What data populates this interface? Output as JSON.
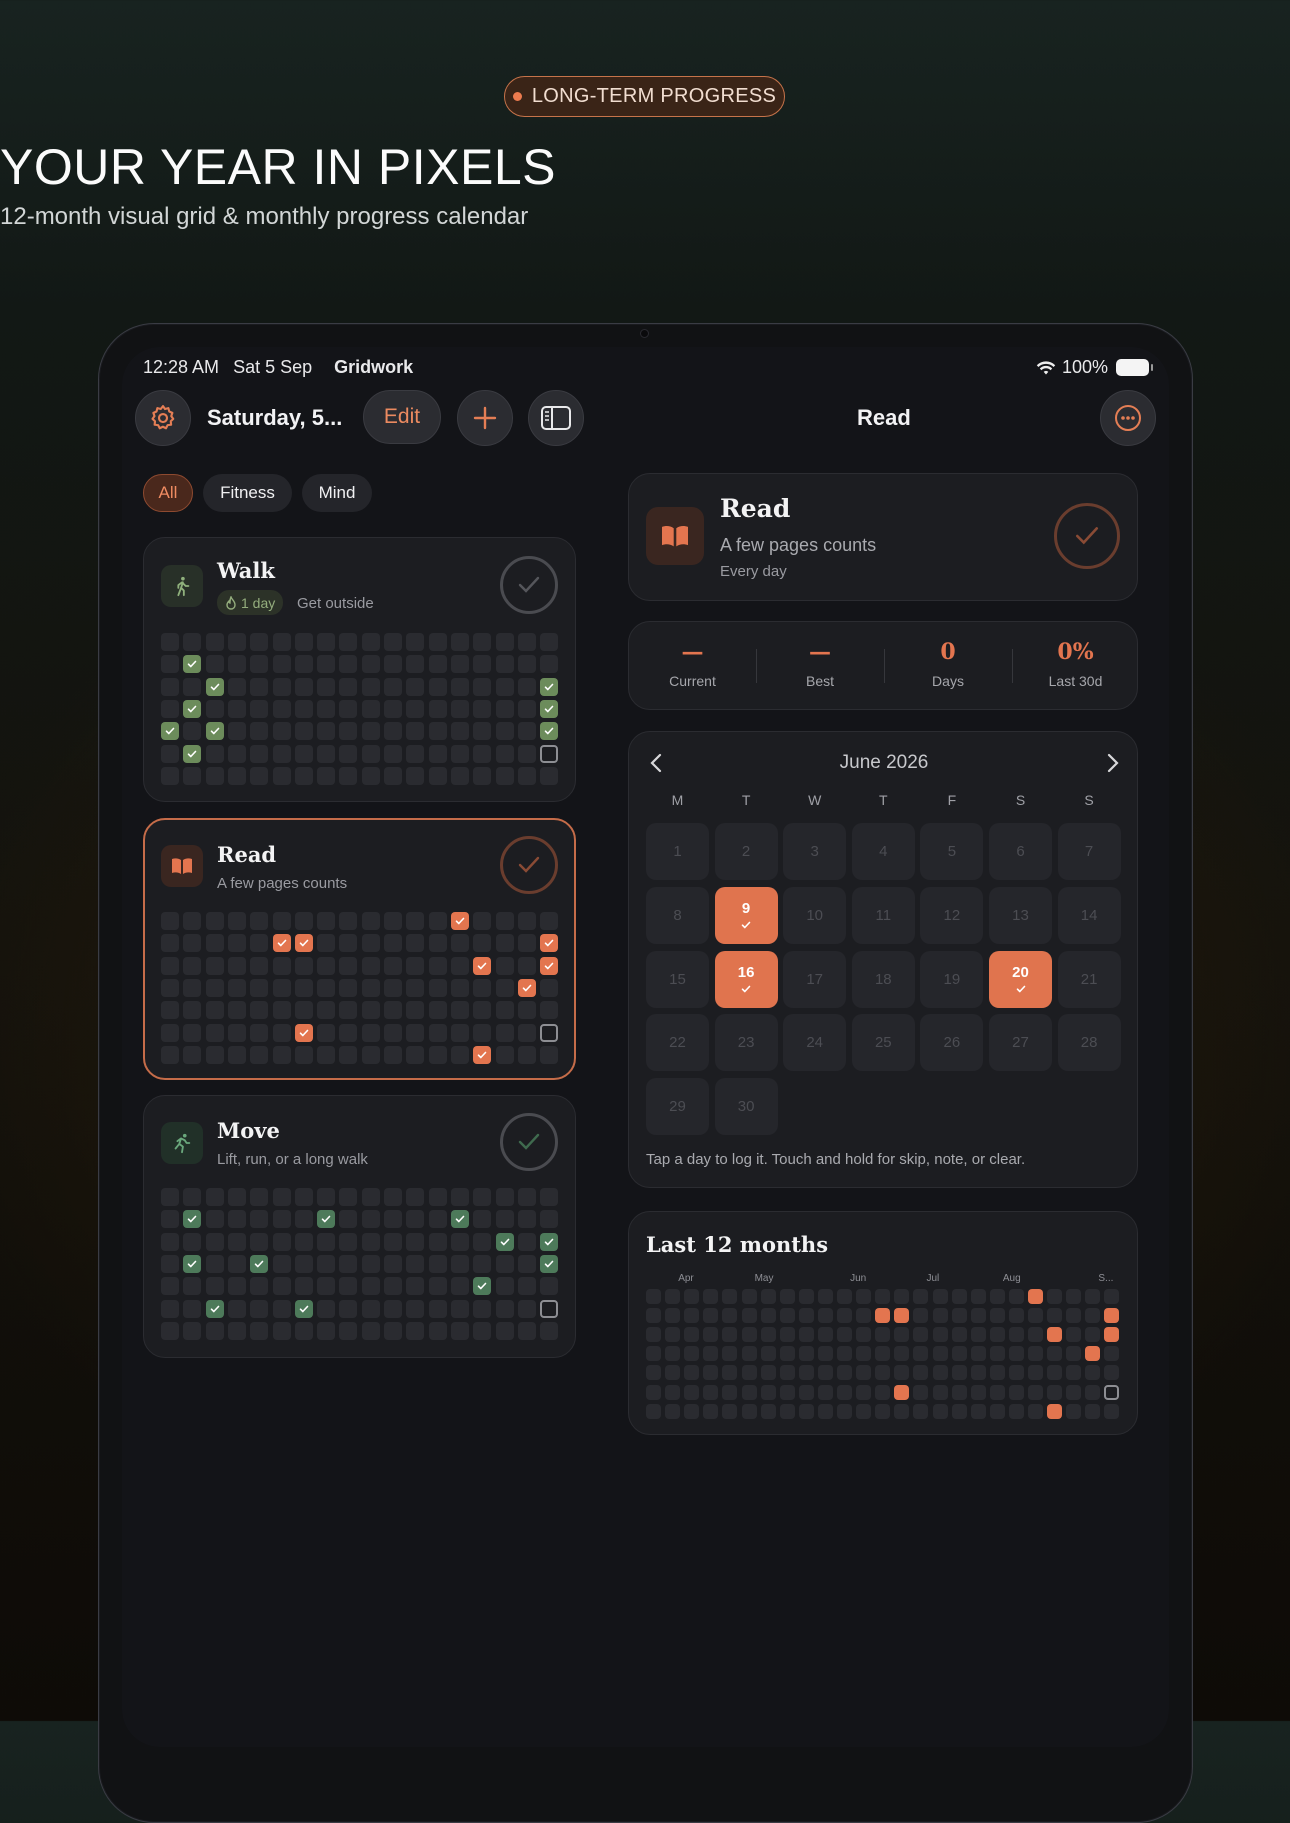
{
  "hero": {
    "pill": "LONG-TERM PROGRESS",
    "title": "YOUR YEAR IN PIXELS",
    "subtitle": "12-month visual grid & monthly progress calendar"
  },
  "status_bar": {
    "time": "12:28 AM",
    "date": "Sat 5 Sep",
    "app": "Gridwork",
    "battery": "100%"
  },
  "toolbar": {
    "date_title": "Saturday, 5...",
    "edit_label": "Edit",
    "detail_title": "Read"
  },
  "filters": [
    "All",
    "Fitness",
    "Mind"
  ],
  "habits": [
    {
      "name": "Walk",
      "streak": "1 day",
      "subtitle": "Get outside",
      "color": "#6c8c5b",
      "icon": "walk-icon",
      "done": [
        [
          1,
          1
        ],
        [
          2,
          2
        ],
        [
          3,
          1
        ],
        [
          4,
          0
        ],
        [
          4,
          2
        ],
        [
          5,
          1
        ],
        [
          2,
          17
        ],
        [
          3,
          17
        ],
        [
          4,
          17
        ]
      ],
      "today": [
        5,
        17
      ]
    },
    {
      "name": "Read",
      "subtitle": "A few pages counts",
      "color": "#e3754f",
      "icon": "book-icon",
      "done": [
        [
          0,
          13
        ],
        [
          1,
          5
        ],
        [
          1,
          6
        ],
        [
          1,
          17
        ],
        [
          2,
          14
        ],
        [
          2,
          17
        ],
        [
          3,
          16
        ],
        [
          5,
          6
        ],
        [
          6,
          14
        ]
      ],
      "today": [
        5,
        17
      ]
    },
    {
      "name": "Move",
      "subtitle": "Lift, run, or a long walk",
      "color": "#4d7a5a",
      "icon": "run-icon",
      "done": [
        [
          1,
          1
        ],
        [
          1,
          7
        ],
        [
          1,
          13
        ],
        [
          2,
          15
        ],
        [
          2,
          17
        ],
        [
          3,
          1
        ],
        [
          3,
          4
        ],
        [
          3,
          17
        ],
        [
          4,
          14
        ],
        [
          5,
          2
        ],
        [
          5,
          6
        ]
      ],
      "today": [
        5,
        17
      ]
    }
  ],
  "detail": {
    "name": "Read",
    "subtitle": "A few pages counts",
    "frequency": "Every day",
    "stats": [
      {
        "value": "—",
        "label": "Current"
      },
      {
        "value": "—",
        "label": "Best"
      },
      {
        "value": "0",
        "label": "Days"
      },
      {
        "value": "0%",
        "label": "Last 30d"
      }
    ],
    "calendar": {
      "month": "June 2026",
      "weekdays": [
        "M",
        "T",
        "W",
        "T",
        "F",
        "S",
        "S"
      ],
      "days": [
        "1",
        "2",
        "3",
        "4",
        "5",
        "6",
        "7",
        "8",
        "9",
        "10",
        "11",
        "12",
        "13",
        "14",
        "15",
        "16",
        "17",
        "18",
        "19",
        "20",
        "21",
        "22",
        "23",
        "24",
        "25",
        "26",
        "27",
        "28",
        "29",
        "30"
      ],
      "completed": [
        "9",
        "16",
        "20"
      ],
      "hint": "Tap a day to log it. Touch and hold for skip, note, or clear."
    },
    "year": {
      "title": "Last 12 months",
      "month_labels": [
        "Apr",
        "May",
        "Jun",
        "Jul",
        "Aug",
        "S..."
      ],
      "done": [
        [
          0,
          20
        ],
        [
          1,
          12
        ],
        [
          1,
          13
        ],
        [
          1,
          24
        ],
        [
          2,
          21
        ],
        [
          2,
          24
        ],
        [
          3,
          23
        ],
        [
          5,
          13
        ],
        [
          6,
          21
        ]
      ],
      "today": [
        5,
        24
      ]
    }
  }
}
